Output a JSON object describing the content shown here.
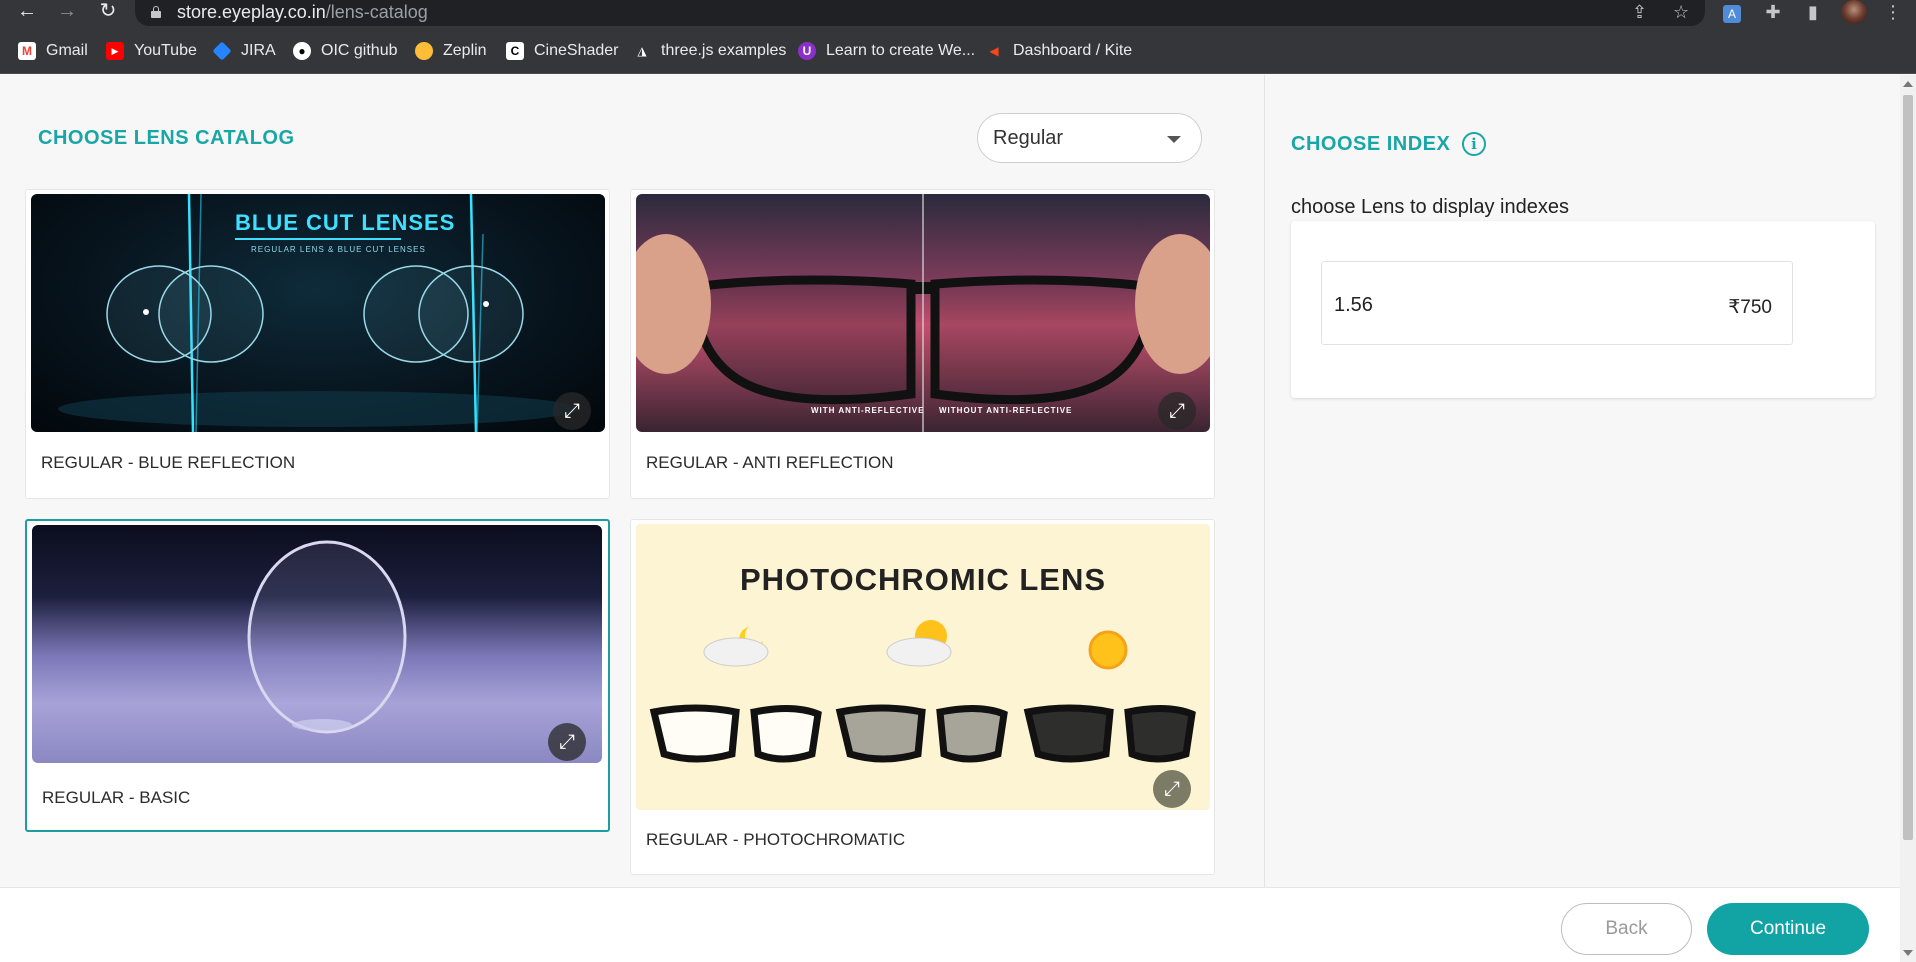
{
  "browser": {
    "url_host": "store.eyeplay.co.in",
    "url_path": "/lens-catalog",
    "bookmarks": [
      {
        "label": "Gmail"
      },
      {
        "label": "YouTube"
      },
      {
        "label": "JIRA"
      },
      {
        "label": "OIC github"
      },
      {
        "label": "Zeplin"
      },
      {
        "label": "CineShader"
      },
      {
        "label": "three.js examples"
      },
      {
        "label": "Learn to create We..."
      },
      {
        "label": "Dashboard / Kite"
      }
    ]
  },
  "catalog": {
    "title": "CHOOSE LENS CATALOG",
    "filter_value": "Regular",
    "cards": [
      {
        "label": "REGULAR - BLUE REFLECTION",
        "image_title": "BLUE CUT LENSES",
        "image_subtitle": "REGULAR LENS & BLUE CUT LENSES",
        "selected": false
      },
      {
        "label": "REGULAR - ANTI REFLECTION",
        "image_caption_left": "WITH ANTI-REFLECTIVE",
        "image_caption_right": "WITHOUT ANTI-REFLECTIVE",
        "selected": false
      },
      {
        "label": "REGULAR - BASIC",
        "selected": true
      },
      {
        "label": "REGULAR - PHOTOCHROMATIC",
        "image_title": "PHOTOCHROMIC  LENS",
        "selected": false
      }
    ]
  },
  "index": {
    "title": "CHOOSE INDEX",
    "hint": "choose Lens to display indexes",
    "options": [
      {
        "index": "1.56",
        "price": "₹750"
      }
    ]
  },
  "footer": {
    "back_label": "Back",
    "continue_label": "Continue"
  },
  "colors": {
    "accent": "#12a3a4",
    "title": "#1aa6a6",
    "chrome": "#35363a"
  }
}
